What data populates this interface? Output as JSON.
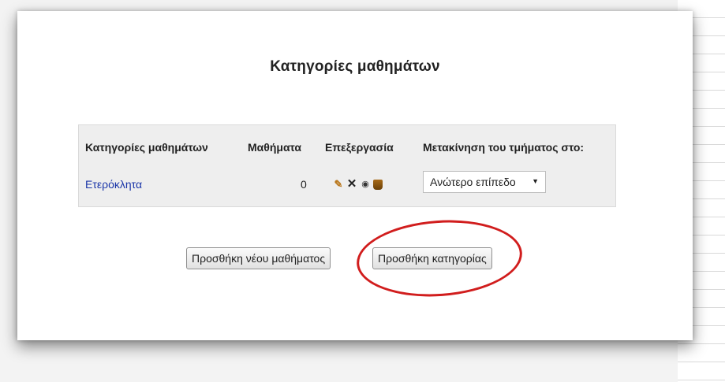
{
  "page": {
    "title": "Κατηγορίες μαθημάτων"
  },
  "table": {
    "headers": [
      "Κατηγορίες μαθημάτων",
      "Μαθήματα",
      "Επεξεργασία",
      "Μετακίνηση του τμήματος στο:"
    ],
    "rows": [
      {
        "category": "Ετερόκλητα",
        "courses": "0",
        "edit_icons": [
          "edit-icon",
          "delete-icon",
          "visibility-eye-icon",
          "assign-roles-icon"
        ],
        "move_to": "Ανώτερο επίπεδο"
      }
    ]
  },
  "actions": {
    "add_course": "Προσθήκη νέου μαθήματος",
    "add_category": "Προσθήκη κατηγορίας"
  },
  "annotation": {
    "highlight_color": "#d11d1d",
    "highlighted": "add_category"
  },
  "colors": {
    "link": "#1a35a8",
    "table_bg": "#eeeeee"
  }
}
